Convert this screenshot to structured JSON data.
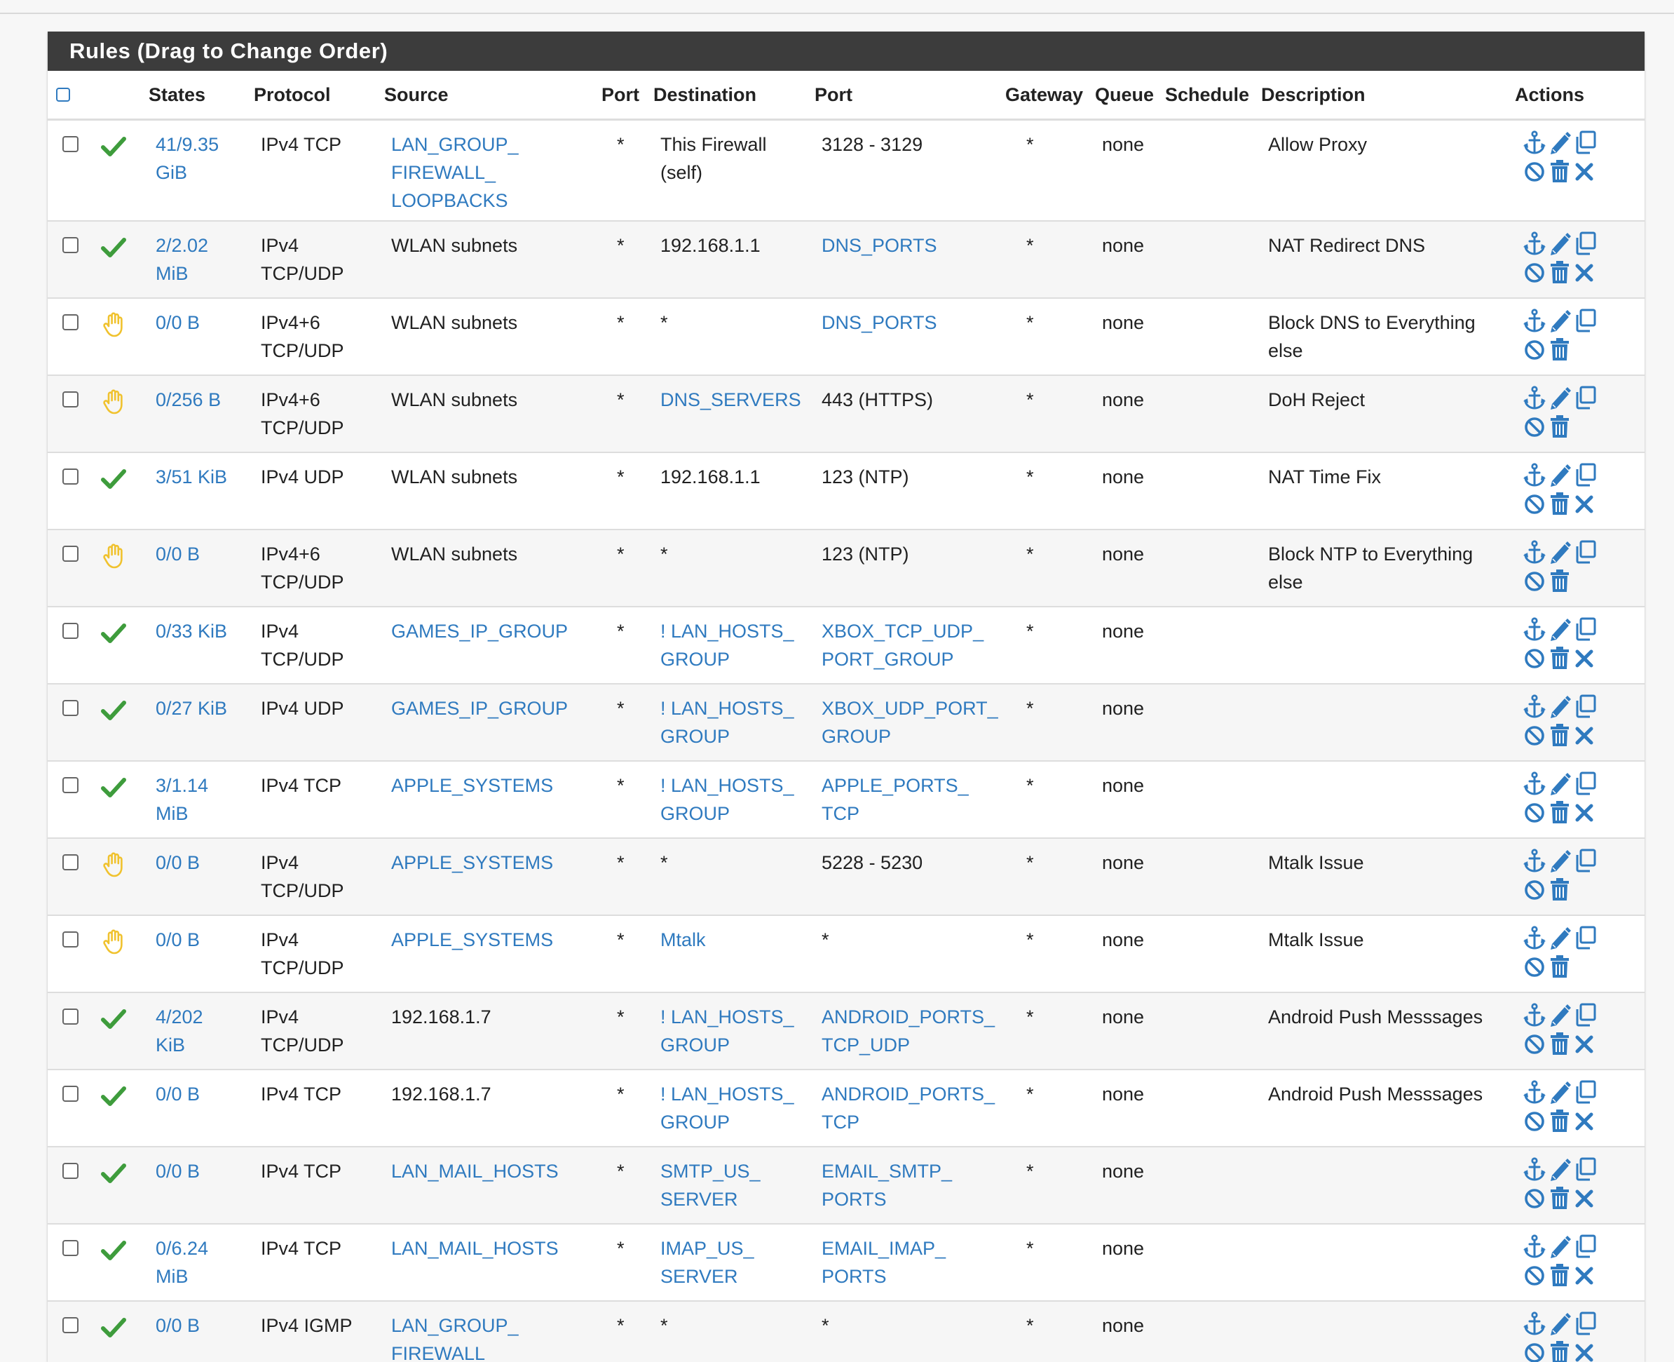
{
  "panel": {
    "title": "Rules (Drag to Change Order)"
  },
  "columns": {
    "states": "States",
    "protocol": "Protocol",
    "source": "Source",
    "port": "Port",
    "destination": "Destination",
    "dest_port": "Port",
    "gateway": "Gateway",
    "queue": "Queue",
    "schedule": "Schedule",
    "description": "Description",
    "actions": "Actions"
  },
  "colors": {
    "accent": "#2f7abf",
    "pass": "#3e9c3c",
    "block": "#f0c22e",
    "header": "#3c3c3c"
  },
  "rows": [
    {
      "status": "check-icon",
      "states": [
        "41/9.35",
        "GiB"
      ],
      "protocol": [
        "IPv4 TCP"
      ],
      "source": [
        "LAN_GROUP_",
        "FIREWALL_",
        "LOOPBACKS"
      ],
      "source_link": true,
      "port": "*",
      "destination": [
        "This Firewall",
        "(self)"
      ],
      "dest_link": false,
      "dest_port": [
        "3128 - 3129"
      ],
      "dport_link": false,
      "gateway": "*",
      "queue": "none",
      "schedule": "",
      "description": [
        "Allow Proxy"
      ],
      "delete_x": true
    },
    {
      "status": "check-icon",
      "states": [
        "2/2.02",
        "MiB"
      ],
      "protocol": [
        "IPv4",
        "TCP/UDP"
      ],
      "source": [
        "WLAN subnets"
      ],
      "source_link": false,
      "port": "*",
      "destination": [
        "192.168.1.1"
      ],
      "dest_link": false,
      "dest_port": [
        "DNS_PORTS"
      ],
      "dport_link": true,
      "gateway": "*",
      "queue": "none",
      "schedule": "",
      "description": [
        "NAT Redirect DNS"
      ],
      "delete_x": true
    },
    {
      "status": "hand-icon",
      "states": [
        "0/0 B"
      ],
      "protocol": [
        "IPv4+6",
        "TCP/UDP"
      ],
      "source": [
        "WLAN subnets"
      ],
      "source_link": false,
      "port": "*",
      "destination": [
        "*"
      ],
      "dest_link": false,
      "dest_port": [
        "DNS_PORTS"
      ],
      "dport_link": true,
      "gateway": "*",
      "queue": "none",
      "schedule": "",
      "description": [
        "Block DNS to Everything",
        "else"
      ],
      "delete_x": false
    },
    {
      "status": "hand-icon",
      "states": [
        "0/256 B"
      ],
      "protocol": [
        "IPv4+6",
        "TCP/UDP"
      ],
      "source": [
        "WLAN subnets"
      ],
      "source_link": false,
      "port": "*",
      "destination": [
        "DNS_SERVERS"
      ],
      "dest_link": true,
      "dest_port": [
        "443 (HTTPS)"
      ],
      "dport_link": false,
      "gateway": "*",
      "queue": "none",
      "schedule": "",
      "description": [
        "DoH Reject"
      ],
      "delete_x": false
    },
    {
      "status": "check-icon",
      "states": [
        "3/51 KiB"
      ],
      "protocol": [
        "IPv4 UDP"
      ],
      "source": [
        "WLAN subnets"
      ],
      "source_link": false,
      "port": "*",
      "destination": [
        "192.168.1.1"
      ],
      "dest_link": false,
      "dest_port": [
        "123 (NTP)"
      ],
      "dport_link": false,
      "gateway": "*",
      "queue": "none",
      "schedule": "",
      "description": [
        "NAT Time Fix"
      ],
      "delete_x": true
    },
    {
      "status": "hand-icon",
      "states": [
        "0/0 B"
      ],
      "protocol": [
        "IPv4+6",
        "TCP/UDP"
      ],
      "source": [
        "WLAN subnets"
      ],
      "source_link": false,
      "port": "*",
      "destination": [
        "*"
      ],
      "dest_link": false,
      "dest_port": [
        "123 (NTP)"
      ],
      "dport_link": false,
      "gateway": "*",
      "queue": "none",
      "schedule": "",
      "description": [
        "Block NTP to Everything",
        "else"
      ],
      "delete_x": false
    },
    {
      "status": "check-icon",
      "states": [
        "0/33 KiB"
      ],
      "protocol": [
        "IPv4",
        "TCP/UDP"
      ],
      "source": [
        "GAMES_IP_GROUP"
      ],
      "source_link": true,
      "port": "*",
      "destination": [
        "! LAN_HOSTS_",
        "GROUP"
      ],
      "dest_link": true,
      "dest_port": [
        "XBOX_TCP_UDP_",
        "PORT_GROUP"
      ],
      "dport_link": true,
      "gateway": "*",
      "queue": "none",
      "schedule": "",
      "description": [
        ""
      ],
      "delete_x": true
    },
    {
      "status": "check-icon",
      "states": [
        "0/27 KiB"
      ],
      "protocol": [
        "IPv4 UDP"
      ],
      "source": [
        "GAMES_IP_GROUP"
      ],
      "source_link": true,
      "port": "*",
      "destination": [
        "! LAN_HOSTS_",
        "GROUP"
      ],
      "dest_link": true,
      "dest_port": [
        "XBOX_UDP_PORT_",
        "GROUP"
      ],
      "dport_link": true,
      "gateway": "*",
      "queue": "none",
      "schedule": "",
      "description": [
        ""
      ],
      "delete_x": true
    },
    {
      "status": "check-icon",
      "states": [
        "3/1.14",
        "MiB"
      ],
      "protocol": [
        "IPv4 TCP"
      ],
      "source": [
        "APPLE_SYSTEMS"
      ],
      "source_link": true,
      "port": "*",
      "destination": [
        "! LAN_HOSTS_",
        "GROUP"
      ],
      "dest_link": true,
      "dest_port": [
        "APPLE_PORTS_",
        "TCP"
      ],
      "dport_link": true,
      "gateway": "*",
      "queue": "none",
      "schedule": "",
      "description": [
        ""
      ],
      "delete_x": true
    },
    {
      "status": "hand-icon",
      "states": [
        "0/0 B"
      ],
      "protocol": [
        "IPv4",
        "TCP/UDP"
      ],
      "source": [
        "APPLE_SYSTEMS"
      ],
      "source_link": true,
      "port": "*",
      "destination": [
        "*"
      ],
      "dest_link": false,
      "dest_port": [
        "5228 - 5230"
      ],
      "dport_link": false,
      "gateway": "*",
      "queue": "none",
      "schedule": "",
      "description": [
        "Mtalk Issue"
      ],
      "delete_x": false
    },
    {
      "status": "hand-icon",
      "states": [
        "0/0 B"
      ],
      "protocol": [
        "IPv4",
        "TCP/UDP"
      ],
      "source": [
        "APPLE_SYSTEMS"
      ],
      "source_link": true,
      "port": "*",
      "destination": [
        "Mtalk"
      ],
      "dest_link": true,
      "dest_port": [
        "*"
      ],
      "dport_link": false,
      "gateway": "*",
      "queue": "none",
      "schedule": "",
      "description": [
        "Mtalk Issue"
      ],
      "delete_x": false
    },
    {
      "status": "check-icon",
      "states": [
        "4/202",
        "KiB"
      ],
      "protocol": [
        "IPv4",
        "TCP/UDP"
      ],
      "source": [
        "192.168.1.7"
      ],
      "source_link": false,
      "port": "*",
      "destination": [
        "! LAN_HOSTS_",
        "GROUP"
      ],
      "dest_link": true,
      "dest_port": [
        "ANDROID_PORTS_",
        "TCP_UDP"
      ],
      "dport_link": true,
      "gateway": "*",
      "queue": "none",
      "schedule": "",
      "description": [
        "Android Push Messsages"
      ],
      "delete_x": true
    },
    {
      "status": "check-icon",
      "states": [
        "0/0 B"
      ],
      "protocol": [
        "IPv4 TCP"
      ],
      "source": [
        "192.168.1.7"
      ],
      "source_link": false,
      "port": "*",
      "destination": [
        "! LAN_HOSTS_",
        "GROUP"
      ],
      "dest_link": true,
      "dest_port": [
        "ANDROID_PORTS_",
        "TCP"
      ],
      "dport_link": true,
      "gateway": "*",
      "queue": "none",
      "schedule": "",
      "description": [
        "Android Push Messsages"
      ],
      "delete_x": true
    },
    {
      "status": "check-icon",
      "states": [
        "0/0 B"
      ],
      "protocol": [
        "IPv4 TCP"
      ],
      "source": [
        "LAN_MAIL_HOSTS"
      ],
      "source_link": true,
      "port": "*",
      "destination": [
        "SMTP_US_",
        "SERVER"
      ],
      "dest_link": true,
      "dest_port": [
        "EMAIL_SMTP_",
        "PORTS"
      ],
      "dport_link": true,
      "gateway": "*",
      "queue": "none",
      "schedule": "",
      "description": [
        ""
      ],
      "delete_x": true
    },
    {
      "status": "check-icon",
      "states": [
        "0/6.24",
        "MiB"
      ],
      "protocol": [
        "IPv4 TCP"
      ],
      "source": [
        "LAN_MAIL_HOSTS"
      ],
      "source_link": true,
      "port": "*",
      "destination": [
        "IMAP_US_",
        "SERVER"
      ],
      "dest_link": true,
      "dest_port": [
        "EMAIL_IMAP_",
        "PORTS"
      ],
      "dport_link": true,
      "gateway": "*",
      "queue": "none",
      "schedule": "",
      "description": [
        ""
      ],
      "delete_x": true
    },
    {
      "status": "check-icon",
      "states": [
        "0/0 B"
      ],
      "protocol": [
        "IPv4 IGMP"
      ],
      "source": [
        "LAN_GROUP_",
        "FIREWALL_"
      ],
      "source_link": true,
      "port": "*",
      "destination": [
        "*"
      ],
      "dest_link": false,
      "dest_port": [
        "*"
      ],
      "dport_link": false,
      "gateway": "*",
      "queue": "none",
      "schedule": "",
      "description": [
        ""
      ],
      "delete_x": true
    }
  ]
}
